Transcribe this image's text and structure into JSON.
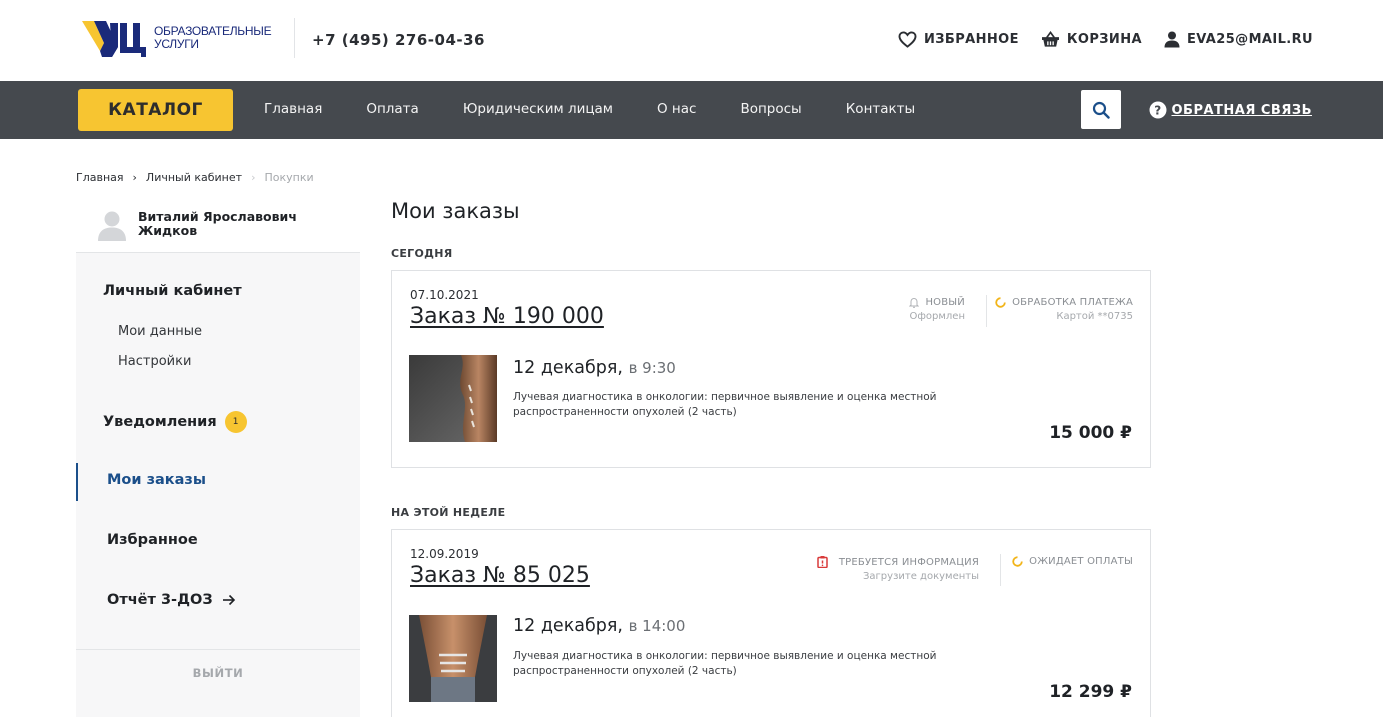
{
  "header": {
    "logo_text_line1": "ОБРАЗОВАТЕЛЬНЫЕ",
    "logo_text_line2": "УСЛУГИ",
    "phone": "+7 (495) 276-04-36",
    "favorites_label": "ИЗБРАННОЕ",
    "cart_label": "КОРЗИНА",
    "user_email": "EVA25@MAIL.RU"
  },
  "nav": {
    "catalog_label": "КАТАЛОГ",
    "items": [
      "Главная",
      "Оплата",
      "Юридическим лицам",
      "О нас",
      "Вопросы",
      "Контакты"
    ],
    "feedback_label": "ОБРАТНАЯ СВЯЗЬ"
  },
  "breadcrumb": {
    "items": [
      "Главная",
      "Личный кабинет",
      "Покупки"
    ]
  },
  "sidebar": {
    "user_name_line1": "Виталий Ярославович",
    "user_name_line2": "Жидков",
    "cabinet_title": "Личный кабинет",
    "my_data": "Мои данные",
    "settings": "Настройки",
    "notifications": "Уведомления",
    "notifications_count": "1",
    "my_orders": "Мои заказы",
    "favorites": "Избранное",
    "report": "Отчёт 3-ДОЗ",
    "logout": "ВЫЙТИ"
  },
  "main": {
    "title": "Мои заказы",
    "groups": [
      {
        "label": "СЕГОДНЯ",
        "order": {
          "date": "07.10.2021",
          "number": "Заказ № 190 000",
          "status1_title": "НОВЫЙ",
          "status1_sub": "Оформлен",
          "status2_title": "ОБРАБОТКА ПЛАТЕЖА",
          "status2_sub": "Картой **0735",
          "event_date": "12 декабря,",
          "event_time": "в 9:30",
          "description": "Лучевая диагностика в онкологии: первичное выявление и оценка местной распространенности опухолей (2 часть)",
          "price": "15 000 ₽"
        }
      },
      {
        "label": "НА ЭТОЙ НЕДЕЛЕ",
        "order": {
          "date": "12.09.2019",
          "number": "Заказ № 85 025",
          "status1_title": "ТРЕБУЕТСЯ ИНФОРМАЦИЯ",
          "status1_sub": "Загрузите документы",
          "status2_title": "ОЖИДАЕТ ОПЛАТЫ",
          "event_date": "12 декабря,",
          "event_time": "в 14:00",
          "description": "Лучевая диагностика в онкологии: первичное выявление и оценка местной распространенности опухолей (2 часть)",
          "price": "12 299 ₽"
        }
      }
    ]
  },
  "colors": {
    "accent_yellow": "#f7c531",
    "nav_bg": "#45494e",
    "active_blue": "#1b4f8a",
    "logo_blue": "#1a2a7a",
    "status_red": "#d93a3a"
  }
}
